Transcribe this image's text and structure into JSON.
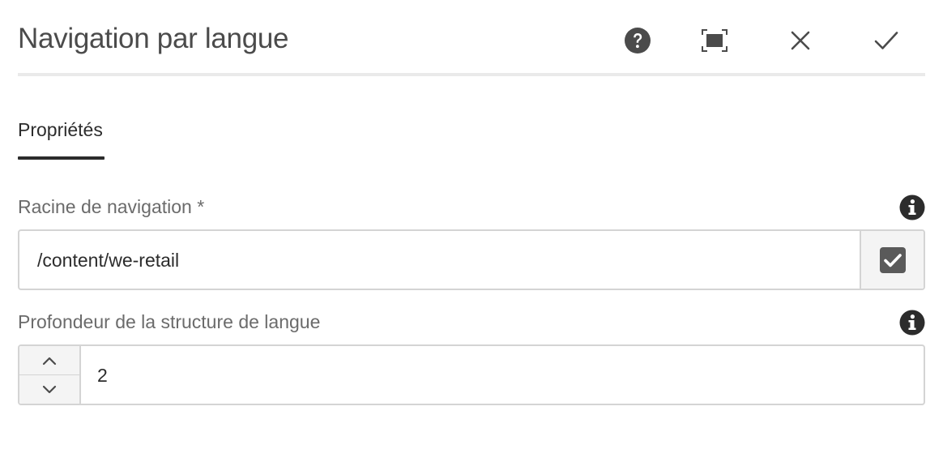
{
  "dialog": {
    "title": "Navigation par langue",
    "header_buttons": [
      {
        "name": "help",
        "icon": "help-circle-icon"
      },
      {
        "name": "fullscreen",
        "icon": "fullscreen-icon"
      },
      {
        "name": "cancel",
        "icon": "close-icon"
      },
      {
        "name": "done",
        "icon": "checkmark-icon"
      }
    ]
  },
  "tabs": [
    {
      "label": "Propriétés",
      "active": true
    }
  ],
  "fields": {
    "navigation_root": {
      "label": "Racine de navigation *",
      "value": "/content/we-retail",
      "info_icon": "info-circle-icon",
      "picker_icon": "checkbox-checked-icon"
    },
    "structure_depth": {
      "label": "Profondeur de la structure de langue",
      "value": "2",
      "info_icon": "info-circle-icon"
    }
  },
  "colors": {
    "text_dark": "#2c2c2c",
    "text_label": "#6b6b6b",
    "border": "#d4d4d4",
    "icon": "#4b4b4b"
  }
}
